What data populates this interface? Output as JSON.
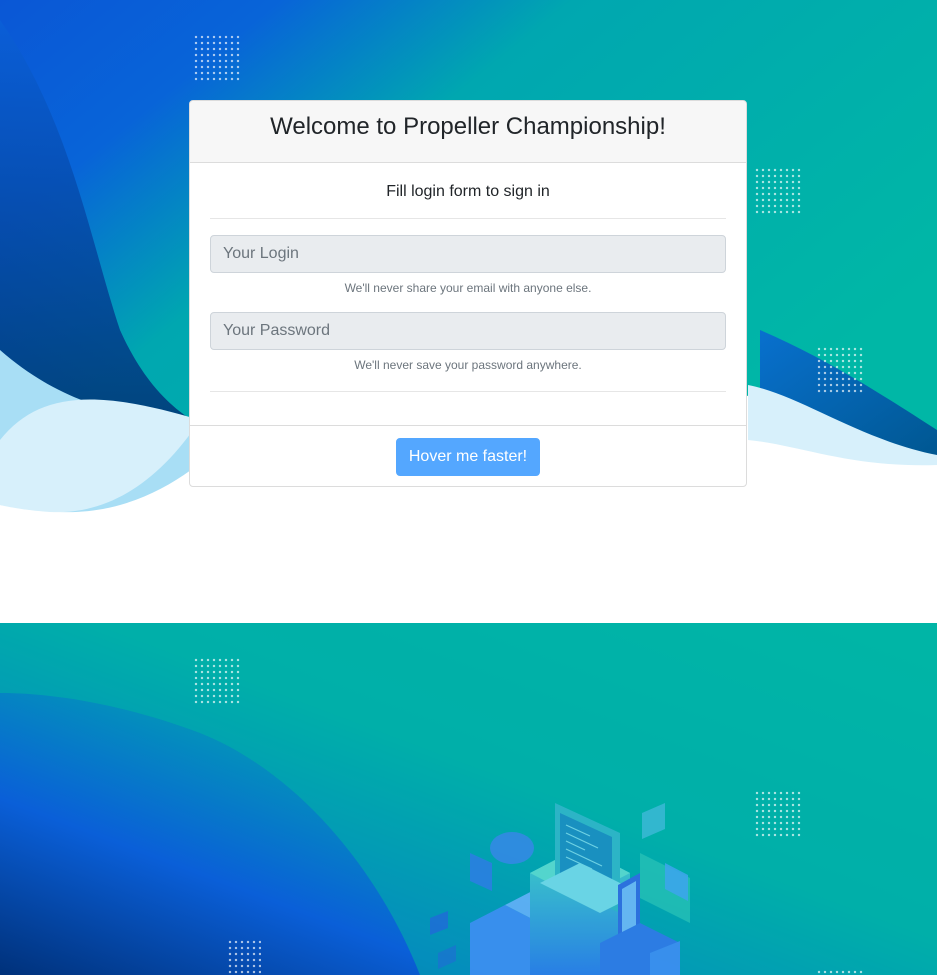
{
  "colors": {
    "teal": "#00b4a6",
    "blue_bright": "#0060d8",
    "blue_dark": "#00357a",
    "light_blue": "#a8def5",
    "card_header_bg": "#f7f7f7",
    "button_bg": "#54a7ff",
    "field_bg": "#e9ecef"
  },
  "login": {
    "title": "Welcome to Propeller Championship!",
    "subtitle": "Fill login form to sign in",
    "login_field": {
      "placeholder": "Your Login",
      "value": "",
      "help": "We'll never share your email with anyone else."
    },
    "password_field": {
      "placeholder": "Your Password",
      "value": "",
      "help": "We'll never save your password anywhere."
    },
    "submit_label": "Hover me faster!"
  },
  "background": {
    "top_decoration": "abstract-wave-illustration",
    "bottom_decoration": "isometric-computer-illustration"
  }
}
